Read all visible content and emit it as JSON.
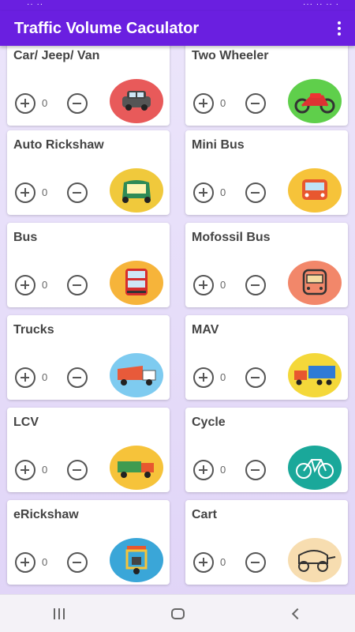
{
  "status_bar": {
    "left": "·· ··",
    "right": "··· ·· ·· ·"
  },
  "app_bar": {
    "title": "Traffic Volume Caculator"
  },
  "vehicles": [
    {
      "name": "Car/ Jeep/ Van",
      "count": "0",
      "icon": "car-icon",
      "icon_bg": "#e85a5a"
    },
    {
      "name": "Two Wheeler",
      "count": "0",
      "icon": "motorcycle-icon",
      "icon_bg": "#5fcf4b"
    },
    {
      "name": "Auto Rickshaw",
      "count": "0",
      "icon": "auto-rickshaw-icon",
      "icon_bg": "#f0c93c"
    },
    {
      "name": "Mini Bus",
      "count": "0",
      "icon": "mini-bus-icon",
      "icon_bg": "#f6c33a"
    },
    {
      "name": "Bus",
      "count": "0",
      "icon": "double-decker-bus-icon",
      "icon_bg": "#f6b43a"
    },
    {
      "name": "Mofossil Bus",
      "count": "0",
      "icon": "bus-front-icon",
      "icon_bg": "#f2876a"
    },
    {
      "name": "Trucks",
      "count": "0",
      "icon": "dump-truck-icon",
      "icon_bg": "#7ecbf0"
    },
    {
      "name": "MAV",
      "count": "0",
      "icon": "container-truck-icon",
      "icon_bg": "#f4d83a"
    },
    {
      "name": "LCV",
      "count": "0",
      "icon": "light-truck-icon",
      "icon_bg": "#f6c33a"
    },
    {
      "name": "Cycle",
      "count": "0",
      "icon": "bicycle-icon",
      "icon_bg": "#1aa89a"
    },
    {
      "name": "eRickshaw",
      "count": "0",
      "icon": "e-rickshaw-icon",
      "icon_bg": "#3aa6d8"
    },
    {
      "name": "Cart",
      "count": "0",
      "icon": "horse-cart-icon",
      "icon_bg": "#f7ddb0"
    }
  ]
}
